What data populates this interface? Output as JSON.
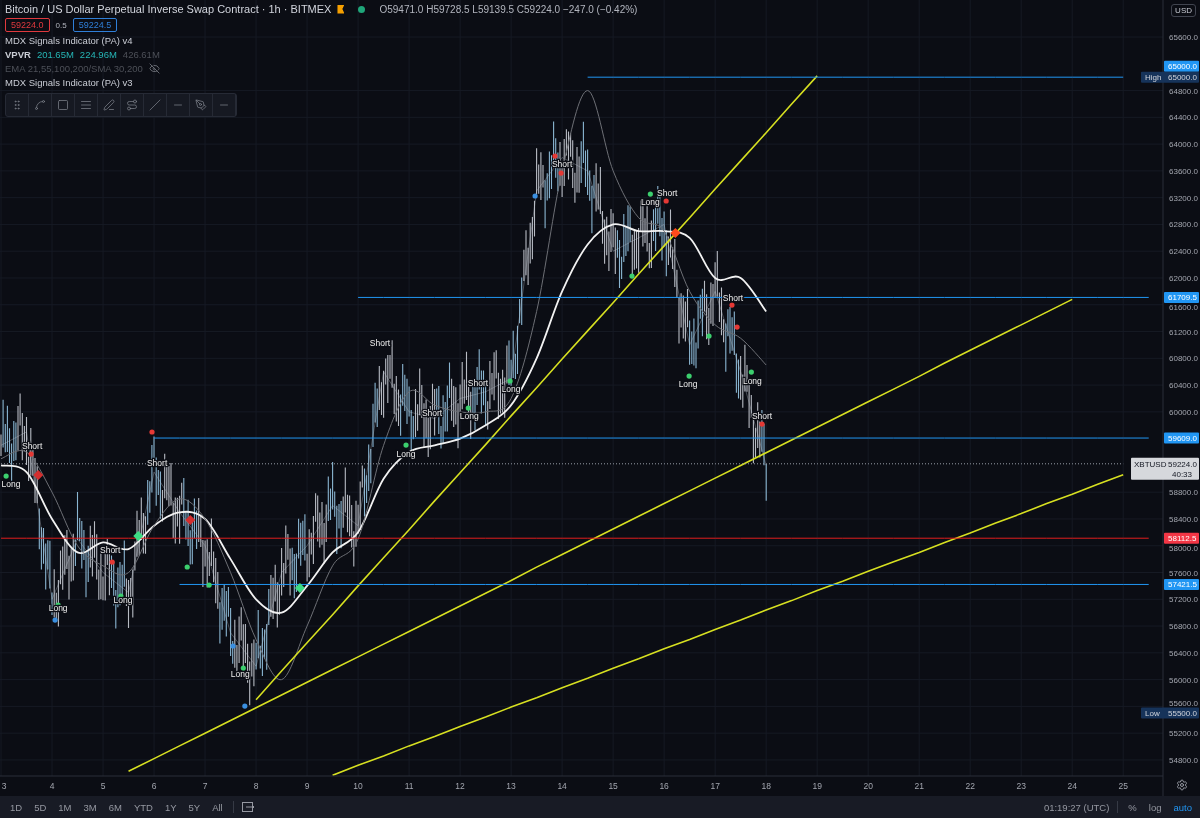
{
  "header": {
    "title": "Bitcoin / US Dollar Perpetual Inverse Swap Contract · 1h · BITMEX",
    "ohlc": "O59471.0 H59728.5 L59139.5 C59224.0 −247.0 (−0.42%)",
    "bid": "59224.0",
    "spread": "0.5",
    "ask": "59224.5"
  },
  "indicators": [
    {
      "name": "MDX Signals Indicator (PA) v4",
      "hidden": false
    },
    {
      "name": "VPVR",
      "values": [
        {
          "text": "201.65M",
          "dim": false
        },
        {
          "text": "224.96M",
          "dim": false
        },
        {
          "text": "426.61M",
          "dim": true
        }
      ],
      "hidden": false
    },
    {
      "name": "EMA 21,55,100,200/SMA 30,200",
      "hidden": true
    },
    {
      "name": "MDX Signals Indicator (PA) v3",
      "hidden": false
    }
  ],
  "currency": "USD",
  "chart_data": {
    "type": "line",
    "grid": true,
    "xlim": [
      2.98,
      25.78
    ],
    "ylim": [
      54560,
      66153
    ],
    "x": [
      3,
      3.5,
      4,
      4.5,
      5,
      5.5,
      6,
      6.5,
      7,
      7.5,
      8,
      8.5,
      9,
      9.5,
      10,
      10.5,
      11,
      11.5,
      12,
      12.5,
      13,
      13.5,
      14,
      14.5,
      15,
      15.5,
      16,
      16.5,
      17,
      17.5,
      18,
      18.5,
      19,
      19.5,
      20,
      20.5,
      21,
      21.5,
      22,
      22.5,
      23,
      23.5,
      24,
      24.5,
      25,
      25.5
    ],
    "series": [
      {
        "color": "#b9c4cf",
        "values": [
          59500,
          59700,
          57200,
          58100,
          57600,
          57300,
          59100,
          58500,
          58000,
          56700,
          56200,
          57600,
          58000,
          58600,
          58300,
          60600,
          60000,
          59900,
          60200,
          60300,
          60500,
          63300,
          63800,
          63600,
          62400,
          62600,
          62800,
          61000,
          61800,
          60600,
          59200,
          null,
          null,
          null,
          null,
          null,
          null,
          null,
          null,
          null,
          null,
          null,
          null,
          null,
          null,
          null
        ]
      },
      {
        "color": "#f2f2f2",
        "values": [
          59200,
          59100,
          58400,
          57900,
          58050,
          57950,
          58300,
          58500,
          58400,
          57800,
          57200,
          57000,
          57400,
          57900,
          58200,
          59000,
          59400,
          59500,
          59600,
          59800,
          60100,
          60800,
          61800,
          62500,
          62800,
          62700,
          62700,
          62600,
          62000,
          62000,
          61500,
          null,
          null,
          null,
          null,
          null,
          null,
          null,
          null,
          null,
          null,
          null,
          null,
          null,
          null,
          null
        ]
      },
      {
        "color": "#6d6f75",
        "values": [
          59300,
          59400,
          58800,
          58000,
          57700,
          57600,
          58300,
          58700,
          58400,
          57600,
          56600,
          56000,
          56800,
          57700,
          58100,
          59500,
          60300,
          60100,
          60000,
          60000,
          60200,
          61500,
          63600,
          64800,
          63600,
          62900,
          62700,
          61800,
          61300,
          61100,
          60700,
          null,
          null,
          null,
          null,
          null,
          null,
          null,
          null,
          null,
          null,
          null,
          null,
          null,
          null,
          null
        ]
      },
      {
        "color": "#d7e021",
        "values": [
          null,
          null,
          null,
          null,
          null,
          null,
          null,
          null,
          null,
          null,
          55700,
          56130,
          56550,
          56970,
          57400,
          57820,
          58240,
          58670,
          59090,
          59510,
          59940,
          60360,
          60790,
          61210,
          61630,
          62060,
          62480,
          62900,
          63330,
          63750,
          64170,
          64600,
          65020,
          null,
          null,
          null,
          null,
          null,
          null,
          null,
          null,
          null,
          null,
          null,
          null,
          null
        ]
      },
      {
        "color": "#d7e021",
        "values": [
          null,
          null,
          null,
          null,
          null,
          54630,
          54820,
          55010,
          55200,
          55390,
          55580,
          55770,
          55960,
          56150,
          56340,
          56530,
          56720,
          56910,
          57100,
          57290,
          57480,
          57680,
          57870,
          58060,
          58250,
          58440,
          58630,
          58820,
          59010,
          59200,
          59390,
          59580,
          59770,
          59960,
          60150,
          60340,
          60530,
          60730,
          60920,
          61110,
          61300,
          61490,
          61680,
          null,
          null,
          null
        ]
      },
      {
        "color": "#d7e021",
        "values": [
          null,
          null,
          null,
          null,
          null,
          null,
          null,
          null,
          null,
          null,
          null,
          null,
          null,
          54570,
          54720,
          54860,
          55010,
          55150,
          55300,
          55440,
          55590,
          55730,
          55880,
          56020,
          56170,
          56310,
          56460,
          56600,
          56750,
          56890,
          57040,
          57180,
          57330,
          57470,
          57620,
          57760,
          57900,
          58050,
          58190,
          58340,
          58480,
          58630,
          58770,
          58920,
          59060,
          null
        ]
      },
      {
        "color": "#2196f3",
        "values": [
          null,
          null,
          null,
          null,
          null,
          null,
          null,
          null,
          null,
          null,
          null,
          null,
          null,
          null,
          null,
          null,
          null,
          null,
          null,
          null,
          null,
          null,
          null,
          65000,
          65000,
          65000,
          65000,
          65000,
          65000,
          65000,
          65000,
          65000,
          65000,
          65000,
          65000,
          65000,
          65000,
          65000,
          65000,
          65000,
          65000,
          65000,
          65000,
          65000,
          65000,
          null
        ]
      },
      {
        "color": "#2196f3",
        "values": [
          null,
          null,
          null,
          null,
          null,
          null,
          null,
          null,
          null,
          null,
          null,
          null,
          null,
          null,
          61709.5,
          61709.5,
          61709.5,
          61709.5,
          61709.5,
          61709.5,
          61709.5,
          61709.5,
          61709.5,
          61709.5,
          61709.5,
          61709.5,
          61709.5,
          61709.5,
          61709.5,
          61709.5,
          61709.5,
          61709.5,
          61709.5,
          61709.5,
          61709.5,
          61709.5,
          61709.5,
          61709.5,
          61709.5,
          61709.5,
          61709.5,
          61709.5,
          61709.5,
          61709.5,
          61709.5,
          61709.5
        ]
      },
      {
        "color": "#2196f3",
        "values": [
          null,
          null,
          null,
          null,
          null,
          null,
          59609,
          59609,
          59609,
          59609,
          59609,
          59609,
          59609,
          59609,
          59609,
          59609,
          59609,
          59609,
          59609,
          59609,
          59609,
          59609,
          59609,
          59609,
          59609,
          59609,
          59609,
          59609,
          59609,
          59609,
          59609,
          59609,
          59609,
          59609,
          59609,
          59609,
          59609,
          59609,
          59609,
          59609,
          59609,
          59609,
          59609,
          59609,
          59609,
          59609
        ]
      },
      {
        "color": "#9aa0aa",
        "line_style": "dotted",
        "values": [
          59224,
          59224,
          59224,
          59224,
          59224,
          59224,
          59224,
          59224,
          59224,
          59224,
          59224,
          59224,
          59224,
          59224,
          59224,
          59224,
          59224,
          59224,
          59224,
          59224,
          59224,
          59224,
          59224,
          59224,
          59224,
          59224,
          59224,
          59224,
          59224,
          59224,
          59224,
          59224,
          59224,
          59224,
          59224,
          59224,
          59224,
          59224,
          59224,
          59224,
          59224,
          59224,
          59224,
          59224,
          59224,
          null
        ]
      },
      {
        "color": "#e01e1e",
        "values": [
          58112.5,
          58112.5,
          58112.5,
          58112.5,
          58112.5,
          58112.5,
          58112.5,
          58112.5,
          58112.5,
          58112.5,
          58112.5,
          58112.5,
          58112.5,
          58112.5,
          58112.5,
          58112.5,
          58112.5,
          58112.5,
          58112.5,
          58112.5,
          58112.5,
          58112.5,
          58112.5,
          58112.5,
          58112.5,
          58112.5,
          58112.5,
          58112.5,
          58112.5,
          58112.5,
          58112.5,
          58112.5,
          58112.5,
          58112.5,
          58112.5,
          58112.5,
          58112.5,
          58112.5,
          58112.5,
          58112.5,
          58112.5,
          58112.5,
          58112.5,
          58112.5,
          58112.5,
          58112.5
        ]
      },
      {
        "color": "#2196f3",
        "values": [
          null,
          null,
          null,
          null,
          null,
          null,
          null,
          57421.5,
          57421.5,
          57421.5,
          57421.5,
          57421.5,
          57421.5,
          57421.5,
          57421.5,
          57421.5,
          57421.5,
          57421.5,
          57421.5,
          57421.5,
          57421.5,
          57421.5,
          57421.5,
          57421.5,
          57421.5,
          57421.5,
          57421.5,
          57421.5,
          57421.5,
          57421.5,
          57421.5,
          57421.5,
          57421.5,
          57421.5,
          57421.5,
          57421.5,
          57421.5,
          57421.5,
          57421.5,
          57421.5,
          57421.5,
          57421.5,
          57421.5,
          57421.5,
          57421.5,
          57421.5
        ]
      }
    ],
    "xticks": [
      3,
      4,
      5,
      6,
      7,
      8,
      9,
      10,
      11,
      12,
      13,
      14,
      15,
      16,
      17,
      18,
      19,
      20,
      21,
      22,
      23,
      24,
      25
    ],
    "yticks": [
      {
        "value": 65600,
        "label": "65600.0"
      },
      {
        "value": 64800,
        "label": "64800.0"
      },
      {
        "value": 64400,
        "label": "64400.0"
      },
      {
        "value": 64000,
        "label": "64000.0"
      },
      {
        "value": 63600,
        "label": "63600.0"
      },
      {
        "value": 63200,
        "label": "63200.0"
      },
      {
        "value": 62800,
        "label": "62800.0"
      },
      {
        "value": 62400,
        "label": "62400.0"
      },
      {
        "value": 62000,
        "label": "62000.0"
      },
      {
        "value": 61600,
        "label": "61600.0"
      },
      {
        "value": 61200,
        "label": "61200.0"
      },
      {
        "value": 60800,
        "label": "60800.0"
      },
      {
        "value": 60400,
        "label": "60400.0"
      },
      {
        "value": 60000,
        "label": "60000.0"
      },
      {
        "value": 58800,
        "label": "58800.0"
      },
      {
        "value": 58400,
        "label": "58400.0"
      },
      {
        "value": 58000,
        "label": "58000.0"
      },
      {
        "value": 57600,
        "label": "57600.0"
      },
      {
        "value": 57200,
        "label": "57200.0"
      },
      {
        "value": 56800,
        "label": "56800.0"
      },
      {
        "value": 56400,
        "label": "56400.0"
      },
      {
        "value": 56000,
        "label": "56000.0"
      },
      {
        "value": 55600,
        "label": "55600.0"
      },
      {
        "value": 55200,
        "label": "55200.0"
      },
      {
        "value": 54800,
        "label": "54800.0"
      }
    ],
    "annotations": [
      "Short",
      "Long",
      "Short",
      "Short",
      "Long",
      "Long",
      "Long",
      "Short",
      "Long",
      "Short",
      "Long",
      "Short",
      "Long",
      "Short",
      "Long",
      "Short",
      "Short",
      "Long",
      "Long",
      "Short"
    ]
  },
  "price_tags": [
    {
      "kind": "level",
      "text": "65000.0",
      "color": "#2196f3"
    },
    {
      "kind": "extreme",
      "label": "High",
      "text": "65000.0"
    },
    {
      "kind": "level",
      "text": "61709.5",
      "color": "#2196f3"
    },
    {
      "kind": "level",
      "text": "59609.0",
      "color": "#2196f3"
    },
    {
      "kind": "last",
      "label": "XBTUSD",
      "text": "59224.0",
      "countdown": "40:33"
    },
    {
      "kind": "level",
      "text": "58112.5",
      "color": "#f23645"
    },
    {
      "kind": "level",
      "text": "57421.5",
      "color": "#2196f3"
    },
    {
      "kind": "extreme",
      "label": "Low",
      "text": "55500.0"
    }
  ],
  "bottom_bar": {
    "ranges": [
      "1D",
      "5D",
      "1M",
      "3M",
      "6M",
      "YTD",
      "1Y",
      "5Y",
      "All"
    ],
    "time": "01:19:27 (UTC)",
    "scale_options": [
      {
        "label": "%",
        "selected": false
      },
      {
        "label": "log",
        "selected": false
      },
      {
        "label": "auto",
        "selected": true
      }
    ]
  }
}
